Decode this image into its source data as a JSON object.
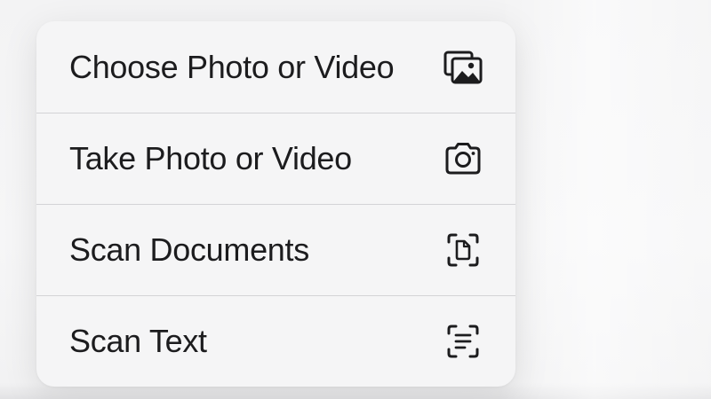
{
  "menu": {
    "items": [
      {
        "label": "Choose Photo or Video",
        "icon": "photo-library-icon"
      },
      {
        "label": "Take Photo or Video",
        "icon": "camera-icon"
      },
      {
        "label": "Scan Documents",
        "icon": "doc-viewfinder-icon"
      },
      {
        "label": "Scan Text",
        "icon": "text-viewfinder-icon"
      }
    ]
  },
  "colors": {
    "menu_background": "#f5f5f6",
    "text": "#1c1c1e",
    "separator": "#d3d3d6",
    "icon": "#1c1c1e"
  }
}
